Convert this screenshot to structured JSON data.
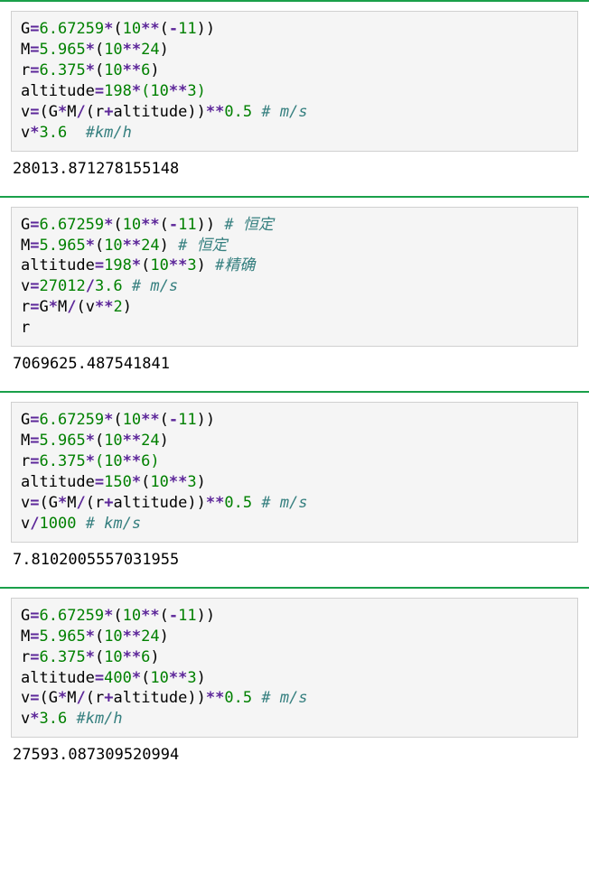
{
  "cells": [
    {
      "lines": [
        [
          {
            "t": "var",
            "v": "G"
          },
          {
            "t": "op",
            "v": "="
          },
          {
            "t": "num",
            "v": "6.67259"
          },
          {
            "t": "op",
            "v": "*"
          },
          {
            "t": "pun",
            "v": "("
          },
          {
            "t": "num",
            "v": "10"
          },
          {
            "t": "op",
            "v": "**"
          },
          {
            "t": "pun",
            "v": "("
          },
          {
            "t": "op",
            "v": "-"
          },
          {
            "t": "num",
            "v": "11"
          },
          {
            "t": "pun",
            "v": ")"
          },
          {
            "t": "pun",
            "v": ")"
          }
        ],
        [
          {
            "t": "var",
            "v": "M"
          },
          {
            "t": "op",
            "v": "="
          },
          {
            "t": "num",
            "v": "5.965"
          },
          {
            "t": "op",
            "v": "*"
          },
          {
            "t": "pun",
            "v": "("
          },
          {
            "t": "num",
            "v": "10"
          },
          {
            "t": "op",
            "v": "**"
          },
          {
            "t": "num",
            "v": "24"
          },
          {
            "t": "pun",
            "v": ")"
          }
        ],
        [
          {
            "t": "var",
            "v": "r"
          },
          {
            "t": "op",
            "v": "="
          },
          {
            "t": "num",
            "v": "6.375"
          },
          {
            "t": "op",
            "v": "*"
          },
          {
            "t": "pun",
            "v": "("
          },
          {
            "t": "num",
            "v": "10"
          },
          {
            "t": "op",
            "v": "**"
          },
          {
            "t": "num",
            "v": "6"
          },
          {
            "t": "pun",
            "v": ")"
          }
        ],
        [
          {
            "t": "var",
            "v": "altitude"
          },
          {
            "t": "op",
            "v": "="
          },
          {
            "t": "num",
            "v": "198"
          },
          {
            "t": "op",
            "v": "*"
          },
          {
            "t": "num",
            "v": "("
          },
          {
            "t": "num",
            "v": "10"
          },
          {
            "t": "op",
            "v": "**"
          },
          {
            "t": "num",
            "v": "3"
          },
          {
            "t": "num",
            "v": ")"
          }
        ],
        [
          {
            "t": "var",
            "v": "v"
          },
          {
            "t": "op",
            "v": "="
          },
          {
            "t": "pun",
            "v": "("
          },
          {
            "t": "var",
            "v": "G"
          },
          {
            "t": "op",
            "v": "*"
          },
          {
            "t": "var",
            "v": "M"
          },
          {
            "t": "op",
            "v": "/"
          },
          {
            "t": "pun",
            "v": "("
          },
          {
            "t": "var",
            "v": "r"
          },
          {
            "t": "op",
            "v": "+"
          },
          {
            "t": "var",
            "v": "altitude"
          },
          {
            "t": "pun",
            "v": ")"
          },
          {
            "t": "pun",
            "v": ")"
          },
          {
            "t": "op",
            "v": "**"
          },
          {
            "t": "num",
            "v": "0.5"
          },
          {
            "t": "var",
            "v": " "
          },
          {
            "t": "com",
            "v": "# m/s"
          }
        ],
        [
          {
            "t": "var",
            "v": "v"
          },
          {
            "t": "op",
            "v": "*"
          },
          {
            "t": "num",
            "v": "3.6"
          },
          {
            "t": "var",
            "v": "  "
          },
          {
            "t": "com",
            "v": "#km/h"
          }
        ]
      ],
      "output": "28013.871278155148"
    },
    {
      "lines": [
        [
          {
            "t": "var",
            "v": "G"
          },
          {
            "t": "op",
            "v": "="
          },
          {
            "t": "num",
            "v": "6.67259"
          },
          {
            "t": "op",
            "v": "*"
          },
          {
            "t": "pun",
            "v": "("
          },
          {
            "t": "num",
            "v": "10"
          },
          {
            "t": "op",
            "v": "**"
          },
          {
            "t": "pun",
            "v": "("
          },
          {
            "t": "op",
            "v": "-"
          },
          {
            "t": "num",
            "v": "11"
          },
          {
            "t": "pun",
            "v": ")"
          },
          {
            "t": "pun",
            "v": ")"
          },
          {
            "t": "var",
            "v": " "
          },
          {
            "t": "com",
            "v": "# 恒定"
          }
        ],
        [
          {
            "t": "var",
            "v": "M"
          },
          {
            "t": "op",
            "v": "="
          },
          {
            "t": "num",
            "v": "5.965"
          },
          {
            "t": "op",
            "v": "*"
          },
          {
            "t": "pun",
            "v": "("
          },
          {
            "t": "num",
            "v": "10"
          },
          {
            "t": "op",
            "v": "**"
          },
          {
            "t": "num",
            "v": "24"
          },
          {
            "t": "pun",
            "v": ")"
          },
          {
            "t": "var",
            "v": " "
          },
          {
            "t": "com",
            "v": "# 恒定"
          }
        ],
        [
          {
            "t": "var",
            "v": "altitude"
          },
          {
            "t": "op",
            "v": "="
          },
          {
            "t": "num",
            "v": "198"
          },
          {
            "t": "op",
            "v": "*"
          },
          {
            "t": "pun",
            "v": "("
          },
          {
            "t": "num",
            "v": "10"
          },
          {
            "t": "op",
            "v": "**"
          },
          {
            "t": "num",
            "v": "3"
          },
          {
            "t": "pun",
            "v": ")"
          },
          {
            "t": "var",
            "v": " "
          },
          {
            "t": "com",
            "v": "#精确"
          }
        ],
        [
          {
            "t": "var",
            "v": "v"
          },
          {
            "t": "op",
            "v": "="
          },
          {
            "t": "num",
            "v": "27012"
          },
          {
            "t": "op",
            "v": "/"
          },
          {
            "t": "num",
            "v": "3.6"
          },
          {
            "t": "var",
            "v": " "
          },
          {
            "t": "com",
            "v": "# m/s"
          }
        ],
        [
          {
            "t": "var",
            "v": "r"
          },
          {
            "t": "op",
            "v": "="
          },
          {
            "t": "var",
            "v": "G"
          },
          {
            "t": "op",
            "v": "*"
          },
          {
            "t": "var",
            "v": "M"
          },
          {
            "t": "op",
            "v": "/"
          },
          {
            "t": "pun",
            "v": "("
          },
          {
            "t": "var",
            "v": "v"
          },
          {
            "t": "op",
            "v": "**"
          },
          {
            "t": "num",
            "v": "2"
          },
          {
            "t": "pun",
            "v": ")"
          }
        ],
        [
          {
            "t": "var",
            "v": "r"
          }
        ]
      ],
      "output": "7069625.487541841"
    },
    {
      "lines": [
        [
          {
            "t": "var",
            "v": "G"
          },
          {
            "t": "op",
            "v": "="
          },
          {
            "t": "num",
            "v": "6.67259"
          },
          {
            "t": "op",
            "v": "*"
          },
          {
            "t": "pun",
            "v": "("
          },
          {
            "t": "num",
            "v": "10"
          },
          {
            "t": "op",
            "v": "**"
          },
          {
            "t": "pun",
            "v": "("
          },
          {
            "t": "op",
            "v": "-"
          },
          {
            "t": "num",
            "v": "11"
          },
          {
            "t": "pun",
            "v": ")"
          },
          {
            "t": "pun",
            "v": ")"
          }
        ],
        [
          {
            "t": "var",
            "v": "M"
          },
          {
            "t": "op",
            "v": "="
          },
          {
            "t": "num",
            "v": "5.965"
          },
          {
            "t": "op",
            "v": "*"
          },
          {
            "t": "pun",
            "v": "("
          },
          {
            "t": "num",
            "v": "10"
          },
          {
            "t": "op",
            "v": "**"
          },
          {
            "t": "num",
            "v": "24"
          },
          {
            "t": "pun",
            "v": ")"
          }
        ],
        [
          {
            "t": "var",
            "v": "r"
          },
          {
            "t": "op",
            "v": "="
          },
          {
            "t": "num",
            "v": "6.375"
          },
          {
            "t": "op",
            "v": "*"
          },
          {
            "t": "num",
            "v": "("
          },
          {
            "t": "num",
            "v": "10"
          },
          {
            "t": "op",
            "v": "**"
          },
          {
            "t": "num",
            "v": "6"
          },
          {
            "t": "num",
            "v": ")"
          }
        ],
        [
          {
            "t": "var",
            "v": "altitude"
          },
          {
            "t": "op",
            "v": "="
          },
          {
            "t": "num",
            "v": "150"
          },
          {
            "t": "op",
            "v": "*"
          },
          {
            "t": "pun",
            "v": "("
          },
          {
            "t": "num",
            "v": "10"
          },
          {
            "t": "op",
            "v": "**"
          },
          {
            "t": "num",
            "v": "3"
          },
          {
            "t": "pun",
            "v": ")"
          }
        ],
        [
          {
            "t": "var",
            "v": "v"
          },
          {
            "t": "op",
            "v": "="
          },
          {
            "t": "pun",
            "v": "("
          },
          {
            "t": "var",
            "v": "G"
          },
          {
            "t": "op",
            "v": "*"
          },
          {
            "t": "var",
            "v": "M"
          },
          {
            "t": "op",
            "v": "/"
          },
          {
            "t": "pun",
            "v": "("
          },
          {
            "t": "var",
            "v": "r"
          },
          {
            "t": "op",
            "v": "+"
          },
          {
            "t": "var",
            "v": "altitude"
          },
          {
            "t": "pun",
            "v": ")"
          },
          {
            "t": "pun",
            "v": ")"
          },
          {
            "t": "op",
            "v": "**"
          },
          {
            "t": "num",
            "v": "0.5"
          },
          {
            "t": "var",
            "v": " "
          },
          {
            "t": "com",
            "v": "# m/s"
          }
        ],
        [
          {
            "t": "var",
            "v": "v"
          },
          {
            "t": "op",
            "v": "/"
          },
          {
            "t": "num",
            "v": "1000"
          },
          {
            "t": "var",
            "v": " "
          },
          {
            "t": "com",
            "v": "# km/s"
          }
        ]
      ],
      "output": "7.8102005557031955"
    },
    {
      "lines": [
        [
          {
            "t": "var",
            "v": "G"
          },
          {
            "t": "op",
            "v": "="
          },
          {
            "t": "num",
            "v": "6.67259"
          },
          {
            "t": "op",
            "v": "*"
          },
          {
            "t": "pun",
            "v": "("
          },
          {
            "t": "num",
            "v": "10"
          },
          {
            "t": "op",
            "v": "**"
          },
          {
            "t": "pun",
            "v": "("
          },
          {
            "t": "op",
            "v": "-"
          },
          {
            "t": "num",
            "v": "11"
          },
          {
            "t": "pun",
            "v": ")"
          },
          {
            "t": "pun",
            "v": ")"
          }
        ],
        [
          {
            "t": "var",
            "v": "M"
          },
          {
            "t": "op",
            "v": "="
          },
          {
            "t": "num",
            "v": "5.965"
          },
          {
            "t": "op",
            "v": "*"
          },
          {
            "t": "pun",
            "v": "("
          },
          {
            "t": "num",
            "v": "10"
          },
          {
            "t": "op",
            "v": "**"
          },
          {
            "t": "num",
            "v": "24"
          },
          {
            "t": "pun",
            "v": ")"
          }
        ],
        [
          {
            "t": "var",
            "v": "r"
          },
          {
            "t": "op",
            "v": "="
          },
          {
            "t": "num",
            "v": "6.375"
          },
          {
            "t": "op",
            "v": "*"
          },
          {
            "t": "pun",
            "v": "("
          },
          {
            "t": "num",
            "v": "10"
          },
          {
            "t": "op",
            "v": "**"
          },
          {
            "t": "num",
            "v": "6"
          },
          {
            "t": "pun",
            "v": ")"
          }
        ],
        [
          {
            "t": "var",
            "v": "altitude"
          },
          {
            "t": "op",
            "v": "="
          },
          {
            "t": "num",
            "v": "400"
          },
          {
            "t": "op",
            "v": "*"
          },
          {
            "t": "pun",
            "v": "("
          },
          {
            "t": "num",
            "v": "10"
          },
          {
            "t": "op",
            "v": "**"
          },
          {
            "t": "num",
            "v": "3"
          },
          {
            "t": "pun",
            "v": ")"
          }
        ],
        [
          {
            "t": "var",
            "v": "v"
          },
          {
            "t": "op",
            "v": "="
          },
          {
            "t": "pun",
            "v": "("
          },
          {
            "t": "var",
            "v": "G"
          },
          {
            "t": "op",
            "v": "*"
          },
          {
            "t": "var",
            "v": "M"
          },
          {
            "t": "op",
            "v": "/"
          },
          {
            "t": "pun",
            "v": "("
          },
          {
            "t": "var",
            "v": "r"
          },
          {
            "t": "op",
            "v": "+"
          },
          {
            "t": "var",
            "v": "altitude"
          },
          {
            "t": "pun",
            "v": ")"
          },
          {
            "t": "pun",
            "v": ")"
          },
          {
            "t": "op",
            "v": "**"
          },
          {
            "t": "num",
            "v": "0.5"
          },
          {
            "t": "var",
            "v": " "
          },
          {
            "t": "com",
            "v": "# m/s"
          }
        ],
        [
          {
            "t": "var",
            "v": "v"
          },
          {
            "t": "op",
            "v": "*"
          },
          {
            "t": "num",
            "v": "3.6"
          },
          {
            "t": "var",
            "v": " "
          },
          {
            "t": "com",
            "v": "#km/h"
          }
        ]
      ],
      "output": "27593.087309520994"
    }
  ]
}
